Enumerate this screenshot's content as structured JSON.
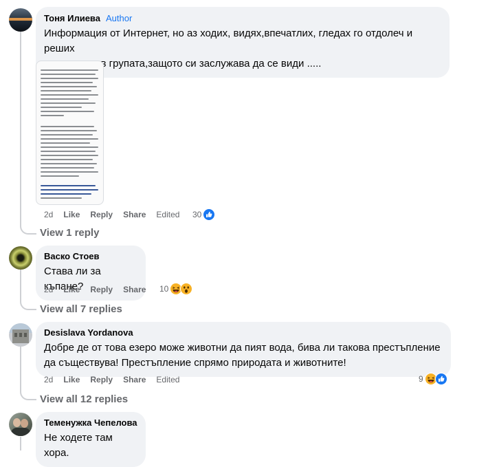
{
  "comments": [
    {
      "author": "Тоня Илиева",
      "badge": "Author",
      "text_line1": "Информация от Интернет, но аз ходих, видях,впечатлих, гледах го отдолеч и реших",
      "text_line2": "да споделя в групата,защото си заслужава да се види .....",
      "time": "2d",
      "like": "Like",
      "reply": "Reply",
      "share": "Share",
      "edited": "Edited",
      "reaction_count": "30",
      "reactions": [
        "like"
      ],
      "view_replies": "View 1 reply",
      "attachment_link_text": "Новините на NOVA - вече в Instagram, Twitter, Telegram и Viber - последвайте ни. За още"
    },
    {
      "author": "Васко Стоев",
      "text": "Става ли за къпане?",
      "time": "2d",
      "like": "Like",
      "reply": "Reply",
      "share": "Share",
      "reaction_count": "10",
      "reactions": [
        "haha",
        "wow"
      ],
      "view_replies": "View all 7 replies"
    },
    {
      "author": "Desislava Yordanova",
      "text_line1": "Добре де от това езеро може животни да пият вода, бива ли такова престъпление",
      "text_line2": "да съществува! Престъпление спрямо природата и животните!",
      "time": "2d",
      "like": "Like",
      "reply": "Reply",
      "share": "Share",
      "edited": "Edited",
      "reaction_count": "9",
      "reactions": [
        "haha",
        "like"
      ],
      "view_replies": "View all 12 replies"
    },
    {
      "author": "Теменужка Чепелова",
      "text": "Не ходете там хора."
    }
  ],
  "colors": {
    "bubble": "#f0f2f5",
    "secondary_text": "#65676b",
    "accent": "#1877f2",
    "haha": "#f7b125",
    "thread_line": "#ced0d4"
  }
}
